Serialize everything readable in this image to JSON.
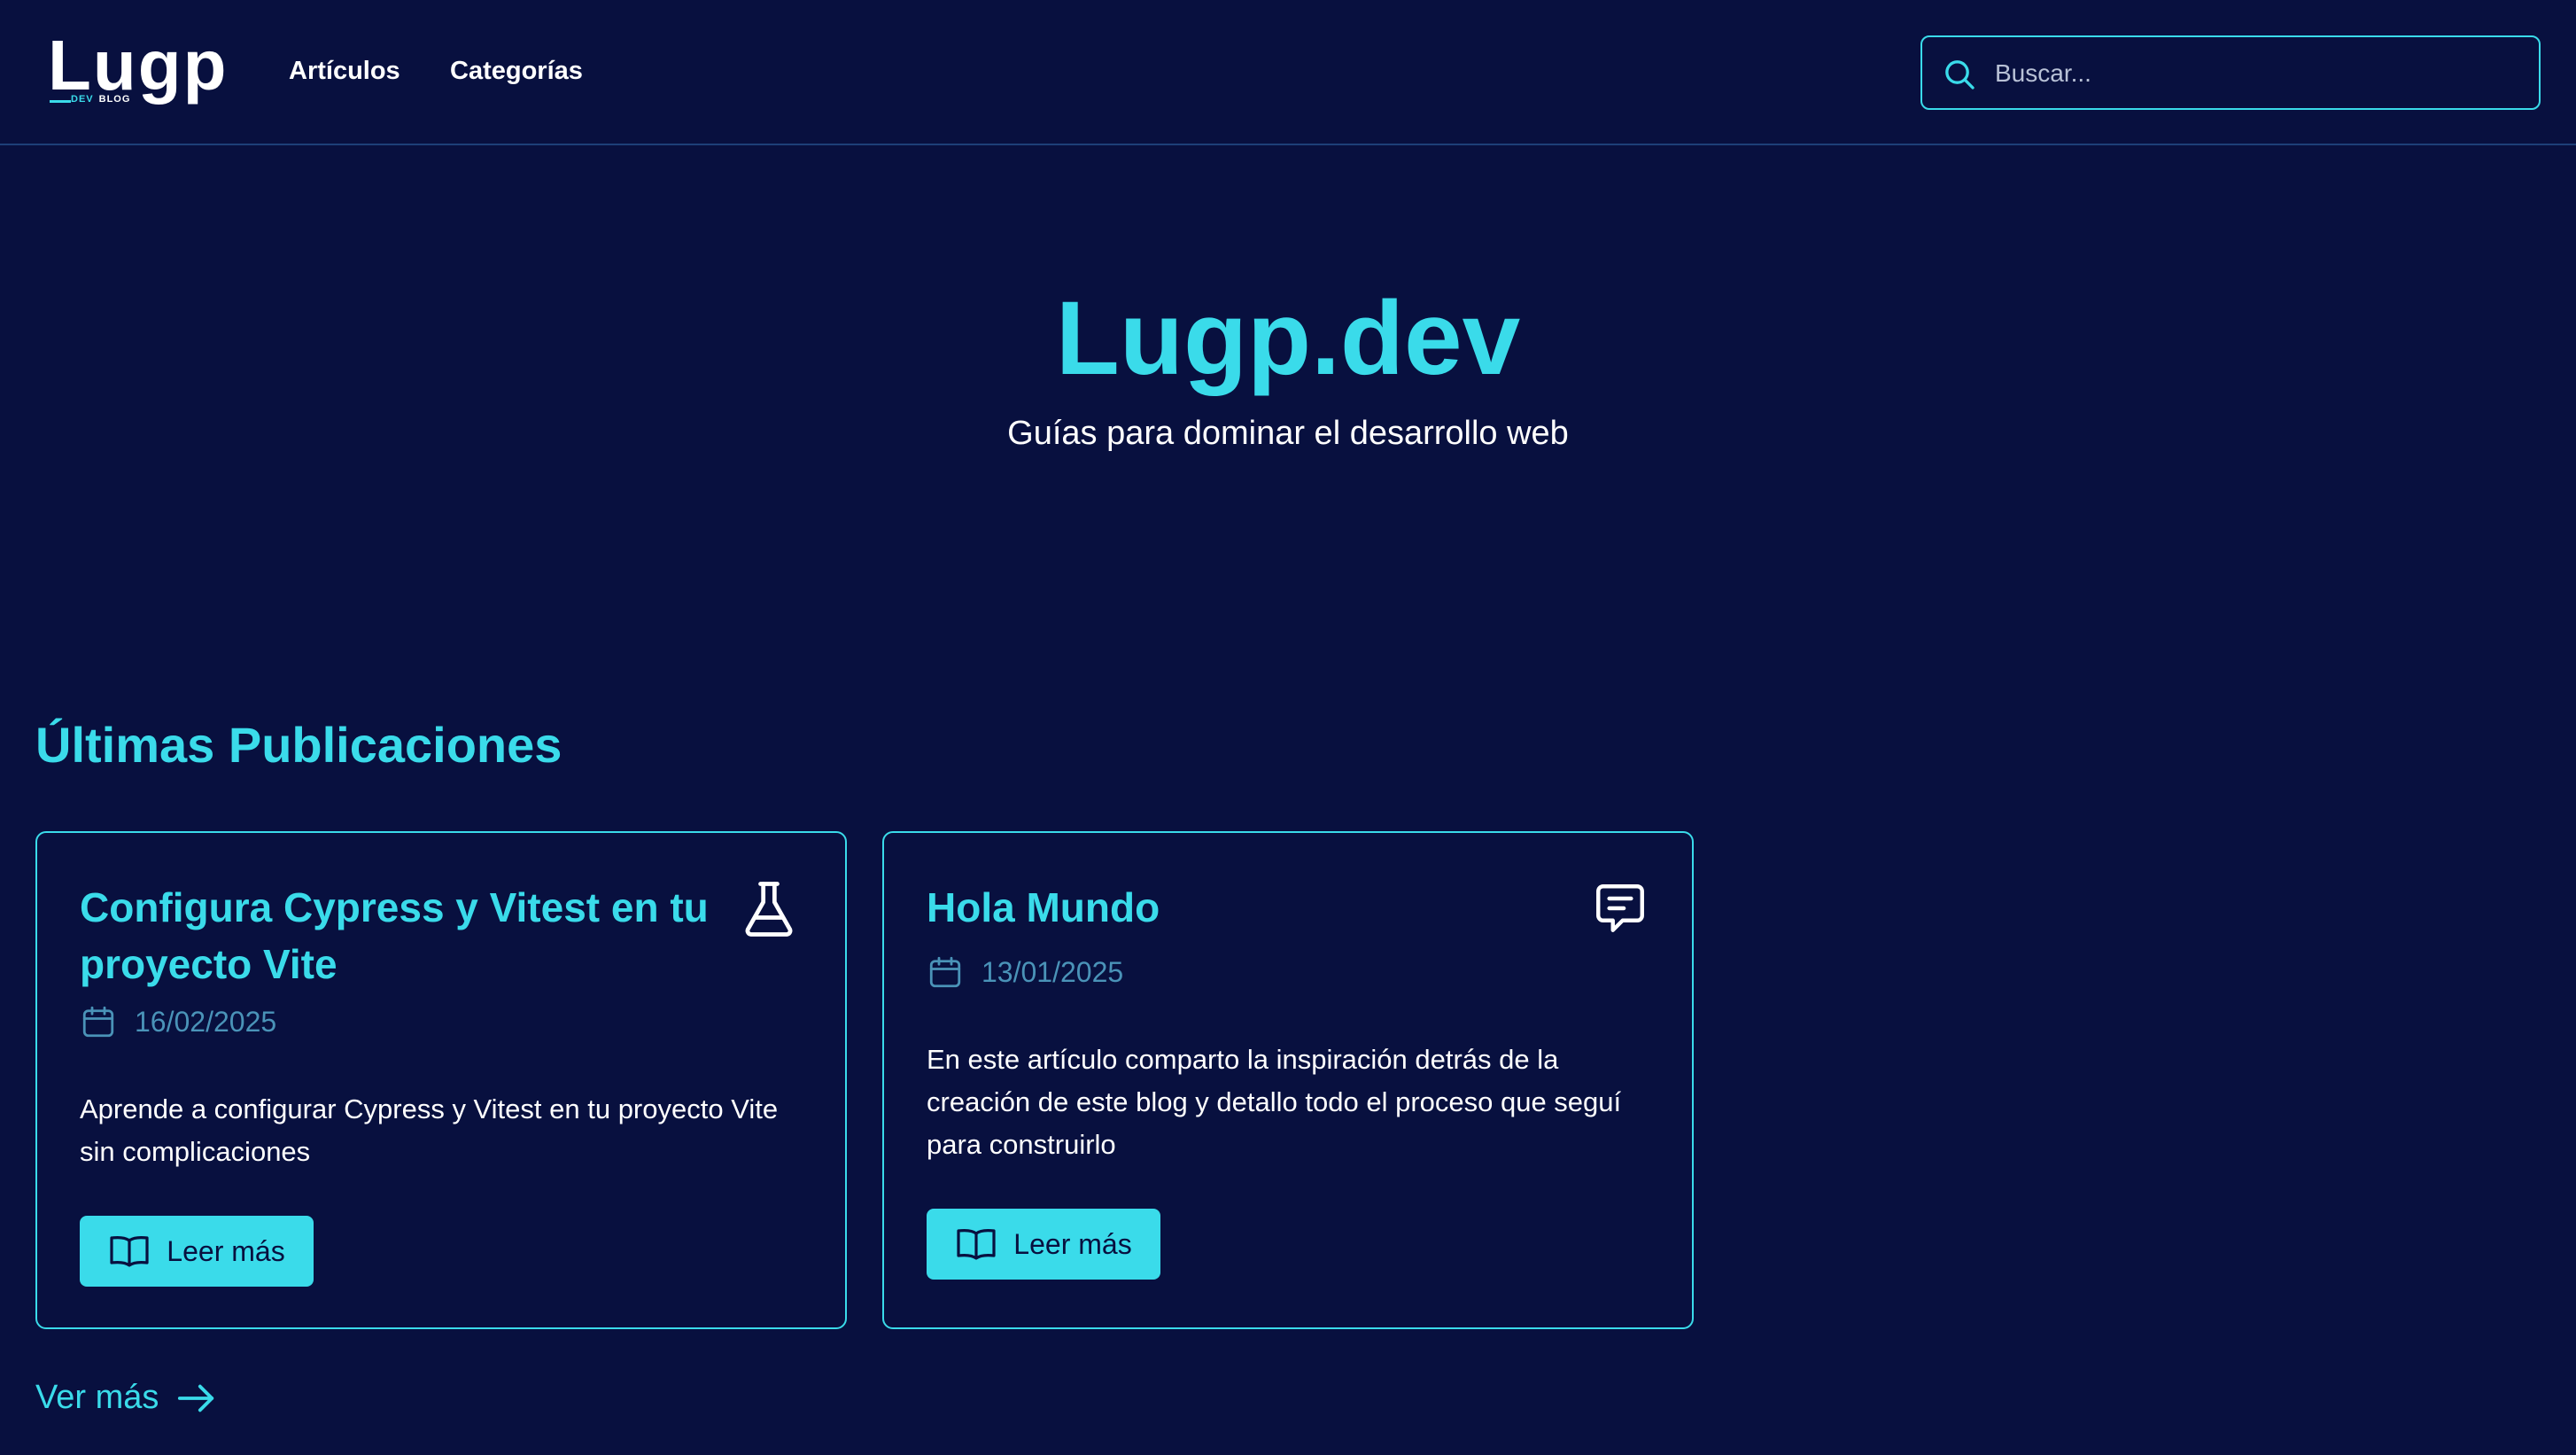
{
  "header": {
    "logo_word": "Lugp",
    "logo_tag_accent": "DEV",
    "logo_tag": "BLOG",
    "nav": [
      {
        "label": "Artículos"
      },
      {
        "label": "Categorías"
      }
    ],
    "search": {
      "placeholder": "Buscar...",
      "value": "",
      "icon": "search-icon"
    }
  },
  "hero": {
    "title": "Lugp.dev",
    "subtitle": "Guías para dominar el desarrollo web"
  },
  "section": {
    "title": "Últimas Publicaciones"
  },
  "posts": [
    {
      "title": "Configura Cypress y Vitest en tu proyecto Vite",
      "icon": "flask-icon",
      "date": "16/02/2025",
      "description": "Aprende a configurar Cypress y Vitest en tu proyecto Vite sin complicaciones",
      "button_label": "Leer más"
    },
    {
      "title": "Hola Mundo",
      "icon": "message-icon",
      "date": "13/01/2025",
      "description": "En este artículo comparto la inspiración detrás de la creación de este blog y detallo todo el proceso que seguí para construirlo",
      "button_label": "Leer más"
    }
  ],
  "more_link": {
    "label": "Ver más",
    "icon": "arrow-right-icon"
  },
  "colors": {
    "background": "#08103f",
    "accent": "#3adbea",
    "date": "#4a93b8",
    "text": "#ffffff"
  }
}
